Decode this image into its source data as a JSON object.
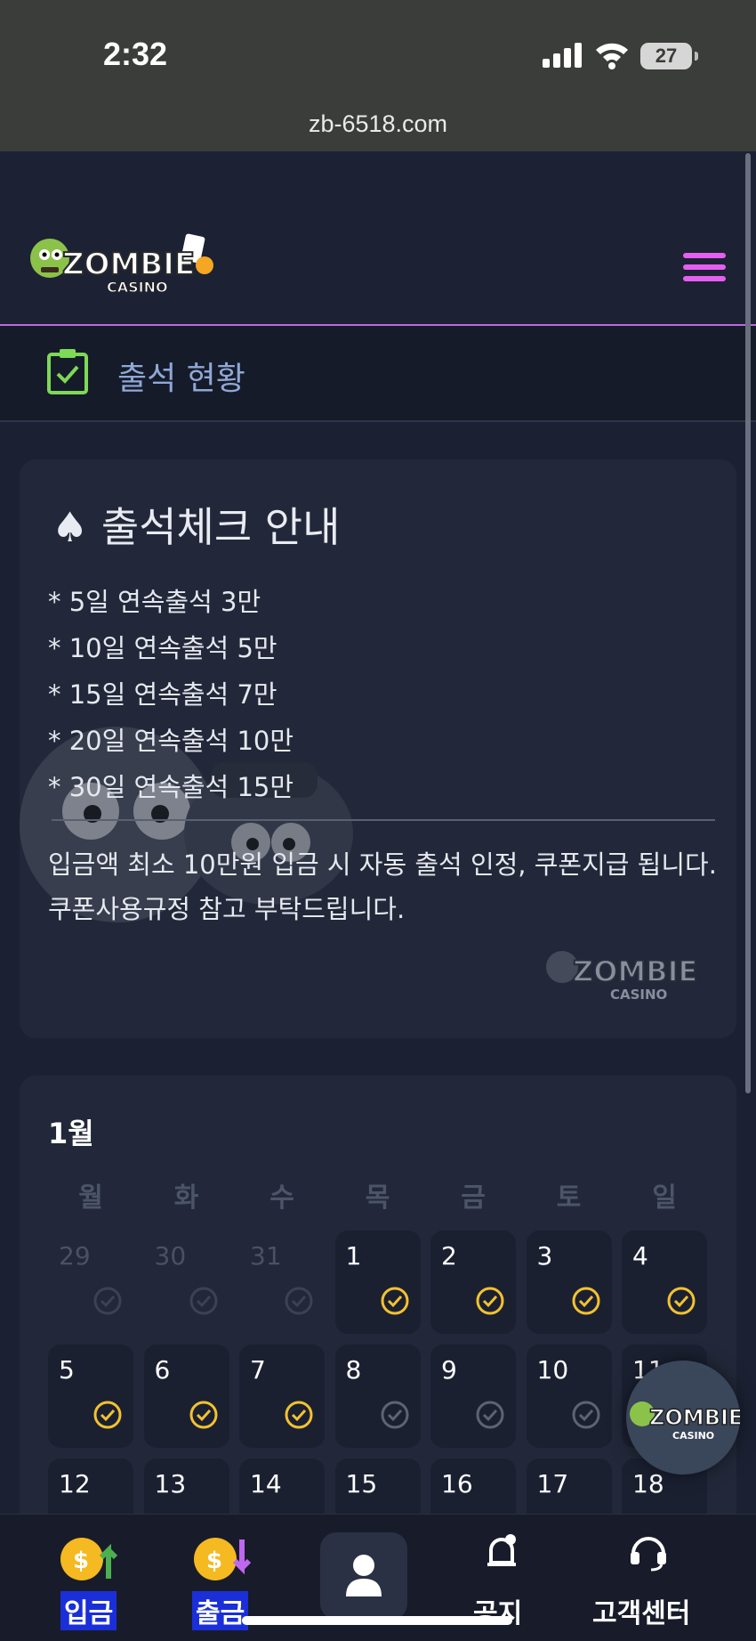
{
  "status_bar": {
    "time": "2:32",
    "battery": "27"
  },
  "browser": {
    "url": "zb-6518.com"
  },
  "header": {
    "logo_alt": "ZOMBIE CASINO"
  },
  "page_title": "출석 현황",
  "notice": {
    "title": "출석체크 안내",
    "rules": [
      "* 5일 연속출석 3만",
      "* 10일 연속출석 5만",
      "* 15일 연속출석 7만",
      "* 20일 연속출석 10만",
      "* 30일 연속출석 15만"
    ],
    "desc_1": "입금액 최소 10만원 입금 시 자동 출석 인정, 쿠폰지급 됩니다.",
    "desc_2": "쿠폰사용규정 참고 부탁드립니다."
  },
  "calendar": {
    "month": "1월",
    "weekdays": [
      "월",
      "화",
      "수",
      "목",
      "금",
      "토",
      "일"
    ],
    "weeks": [
      [
        {
          "d": "29",
          "state": "past"
        },
        {
          "d": "30",
          "state": "past"
        },
        {
          "d": "31",
          "state": "past"
        },
        {
          "d": "1",
          "state": "checked"
        },
        {
          "d": "2",
          "state": "checked"
        },
        {
          "d": "3",
          "state": "checked"
        },
        {
          "d": "4",
          "state": "checked"
        }
      ],
      [
        {
          "d": "5",
          "state": "checked"
        },
        {
          "d": "6",
          "state": "checked"
        },
        {
          "d": "7",
          "state": "checked"
        },
        {
          "d": "8",
          "state": "unchecked"
        },
        {
          "d": "9",
          "state": "unchecked"
        },
        {
          "d": "10",
          "state": "unchecked"
        },
        {
          "d": "11",
          "state": "unchecked"
        }
      ],
      [
        {
          "d": "12",
          "state": "future"
        },
        {
          "d": "13",
          "state": "future"
        },
        {
          "d": "14",
          "state": "future"
        },
        {
          "d": "15",
          "state": "future"
        },
        {
          "d": "16",
          "state": "future"
        },
        {
          "d": "17",
          "state": "future"
        },
        {
          "d": "18",
          "state": "future"
        }
      ]
    ]
  },
  "bottom_nav": {
    "deposit": "입금",
    "withdraw": "출금",
    "notice": "공지",
    "support": "고객센터"
  },
  "colors": {
    "accent": "#e45ff0",
    "check": "#f2c230",
    "title_icon": "#7ed957"
  }
}
